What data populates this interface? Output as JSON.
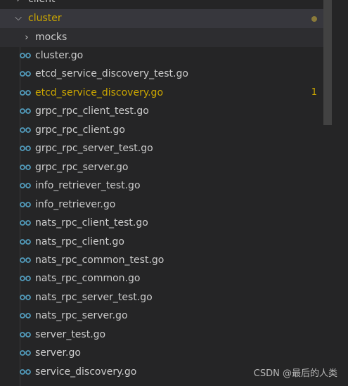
{
  "explorer": {
    "parent_folder": {
      "label": "client"
    },
    "folder": {
      "label": "cluster",
      "has_modified_dot": true
    },
    "subfolder": {
      "label": "mocks"
    },
    "files": [
      {
        "label": "cluster.go",
        "modified": false,
        "badge": ""
      },
      {
        "label": "etcd_service_discovery_test.go",
        "modified": false,
        "badge": ""
      },
      {
        "label": "etcd_service_discovery.go",
        "modified": true,
        "badge": "1"
      },
      {
        "label": "grpc_rpc_client_test.go",
        "modified": false,
        "badge": ""
      },
      {
        "label": "grpc_rpc_client.go",
        "modified": false,
        "badge": ""
      },
      {
        "label": "grpc_rpc_server_test.go",
        "modified": false,
        "badge": ""
      },
      {
        "label": "grpc_rpc_server.go",
        "modified": false,
        "badge": ""
      },
      {
        "label": "info_retriever_test.go",
        "modified": false,
        "badge": ""
      },
      {
        "label": "info_retriever.go",
        "modified": false,
        "badge": ""
      },
      {
        "label": "nats_rpc_client_test.go",
        "modified": false,
        "badge": ""
      },
      {
        "label": "nats_rpc_client.go",
        "modified": false,
        "badge": ""
      },
      {
        "label": "nats_rpc_common_test.go",
        "modified": false,
        "badge": ""
      },
      {
        "label": "nats_rpc_common.go",
        "modified": false,
        "badge": ""
      },
      {
        "label": "nats_rpc_server_test.go",
        "modified": false,
        "badge": ""
      },
      {
        "label": "nats_rpc_server.go",
        "modified": false,
        "badge": ""
      },
      {
        "label": "server_test.go",
        "modified": false,
        "badge": ""
      },
      {
        "label": "server.go",
        "modified": false,
        "badge": ""
      },
      {
        "label": "service_discovery.go",
        "modified": false,
        "badge": ""
      }
    ],
    "file_icon": "go-file-icon",
    "colors": {
      "background": "#252526",
      "selected_row": "#37373d",
      "modified": "#cca700",
      "go_icon": "#519aba"
    }
  },
  "watermark": {
    "text": "CSDN @最后的人类"
  }
}
